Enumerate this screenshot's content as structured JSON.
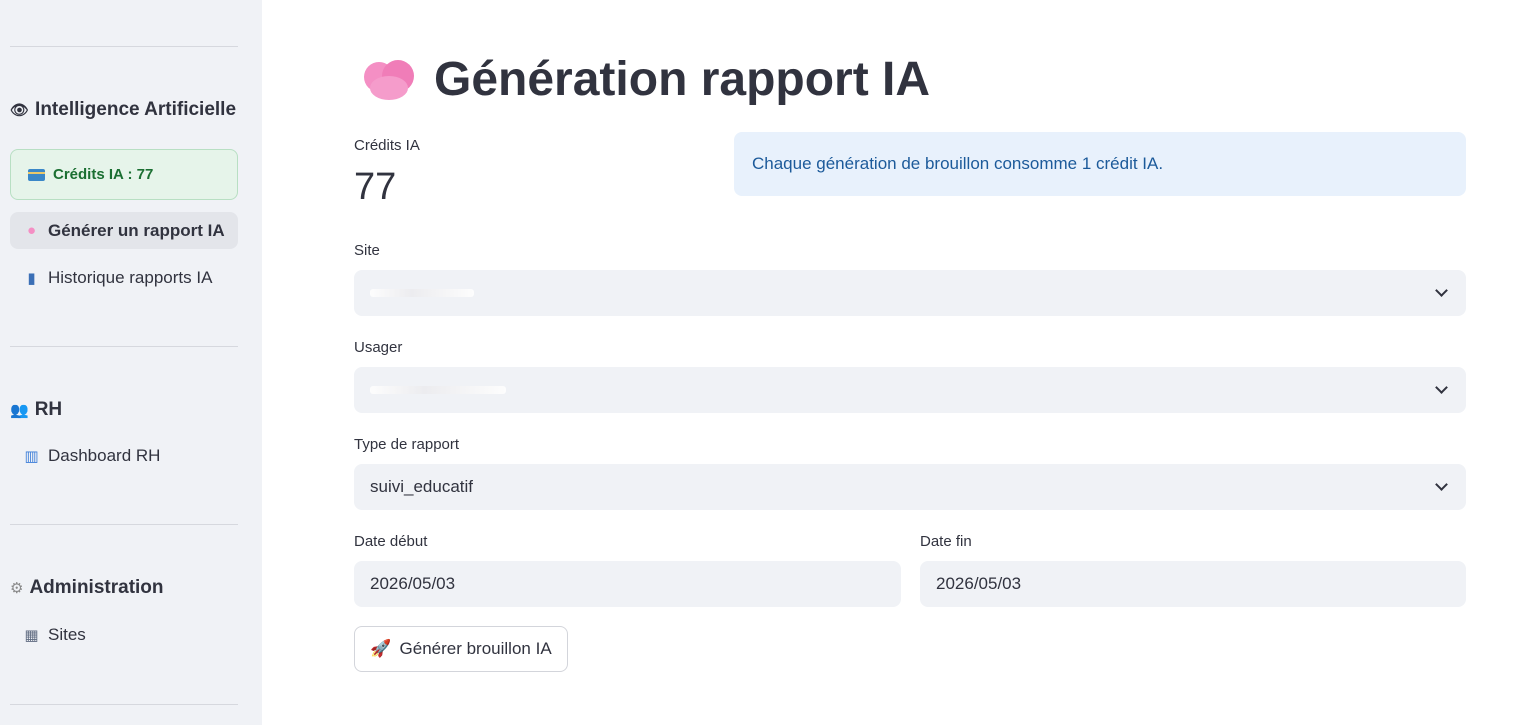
{
  "sidebar": {
    "sections": [
      {
        "title": "Intelligence Artificielle",
        "icon": "eye-icon"
      },
      {
        "title": "RH",
        "icon": "people-icon"
      },
      {
        "title": "Administration",
        "icon": "gear-icon"
      }
    ],
    "credits_label": "Crédits IA : 77",
    "items": [
      {
        "label": "Générer un rapport IA",
        "icon": "brain-icon",
        "active": true
      },
      {
        "label": "Historique rapports IA",
        "icon": "books-icon"
      },
      {
        "label": "Dashboard RH",
        "icon": "bar-chart-icon"
      },
      {
        "label": "Sites",
        "icon": "building-icon"
      }
    ]
  },
  "main": {
    "title": "Génération rapport IA",
    "title_icon": "brain-icon",
    "metric": {
      "label": "Crédits IA",
      "value": "77"
    },
    "info": "Chaque génération de brouillon consomme 1 crédit IA.",
    "fields": {
      "site": {
        "label": "Site",
        "value": ""
      },
      "usager": {
        "label": "Usager",
        "value": ""
      },
      "type": {
        "label": "Type de rapport",
        "value": "suivi_educatif"
      },
      "date_debut": {
        "label": "Date début",
        "value": "2026/05/03"
      },
      "date_fin": {
        "label": "Date fin",
        "value": "2026/05/03"
      }
    },
    "button": {
      "label": "Générer brouillon IA",
      "icon": "rocket-icon"
    }
  },
  "colors": {
    "sidebar_bg": "#f0f2f6",
    "credits_bg": "#e6f4ea",
    "credits_text": "#1b6f32",
    "info_bg": "#e8f1fc",
    "info_text": "#1c5a9a",
    "brain": "#f48fc4"
  }
}
